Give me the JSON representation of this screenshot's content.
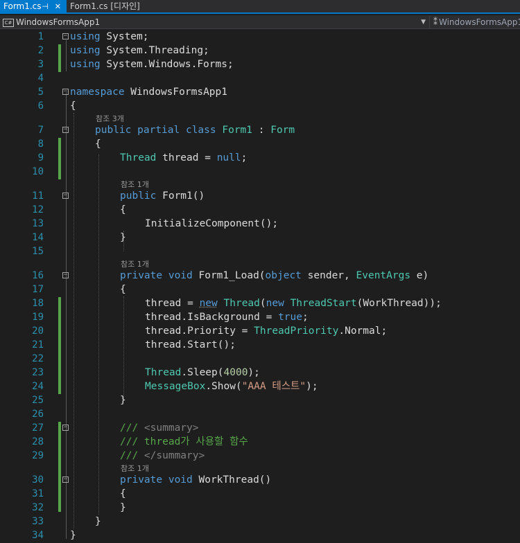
{
  "tabs": [
    {
      "label": "Form1.cs",
      "active": true,
      "pin": "⊣",
      "close": "✕"
    },
    {
      "label": "Form1.cs [디자인]",
      "active": false
    }
  ],
  "nav": {
    "project": "WindowsFormsApp1",
    "project_icon": "C#",
    "class": "WindowsFormsApp1"
  },
  "lens": {
    "ref3": "참조 3개",
    "ref1": "참조 1개"
  },
  "line_numbers": [
    "1",
    "2",
    "3",
    "4",
    "5",
    "6",
    "7",
    "8",
    "9",
    "10",
    "11",
    "12",
    "13",
    "14",
    "15",
    "16",
    "17",
    "18",
    "19",
    "20",
    "21",
    "22",
    "23",
    "24",
    "25",
    "26",
    "27",
    "28",
    "29",
    "30",
    "31",
    "32",
    "33",
    "34"
  ],
  "code": {
    "l1": [
      "using",
      " System;"
    ],
    "l2": [
      "using",
      " System.Threading;"
    ],
    "l3": [
      "using",
      " System.Windows.Forms;"
    ],
    "l5": [
      "namespace",
      " WindowsFormsApp1"
    ],
    "l6": [
      "{"
    ],
    "l7": [
      "public",
      " ",
      "partial",
      " ",
      "class",
      " ",
      "Form1",
      " : ",
      "Form"
    ],
    "l8": [
      "{"
    ],
    "l9": [
      "Thread",
      " thread = ",
      "null",
      ";"
    ],
    "l11": [
      "public",
      " Form1()"
    ],
    "l12": [
      "{"
    ],
    "l13": [
      "InitializeComponent();"
    ],
    "l14": [
      "}"
    ],
    "l16": [
      "private",
      " ",
      "void",
      " Form1_Load(",
      "object",
      " sender, ",
      "EventArgs",
      " e)"
    ],
    "l17": [
      "{"
    ],
    "l18": [
      "thread = ",
      "new",
      " ",
      "Thread",
      "(",
      "new",
      " ",
      "ThreadStart",
      "(WorkThread));"
    ],
    "l19": [
      "thread.IsBackground = ",
      "true",
      ";"
    ],
    "l20": [
      "thread.Priority = ",
      "ThreadPriority",
      ".Normal;"
    ],
    "l21": [
      "thread.Start();"
    ],
    "l23": [
      "Thread",
      ".Sleep(",
      "4000",
      ");"
    ],
    "l24": [
      "MessageBox",
      ".Show(",
      "\"AAA 테스트\"",
      ");"
    ],
    "l25": [
      "}"
    ],
    "l27": [
      "///",
      " <summary>"
    ],
    "l28": [
      "/// thread가 사용할 함수"
    ],
    "l29": [
      "///",
      " </summary>"
    ],
    "l30": [
      "private",
      " ",
      "void",
      " WorkThread()"
    ],
    "l31": [
      "{"
    ],
    "l32": [
      "}"
    ],
    "l33": [
      "}"
    ],
    "l34": [
      "}"
    ]
  },
  "colors": {
    "background": "#1e1e1e",
    "keyword": "#569cd6",
    "type": "#4ec9b0",
    "string": "#d69d85",
    "comment": "#57a64a",
    "line_number": "#2b91af",
    "accent": "#007acc"
  }
}
